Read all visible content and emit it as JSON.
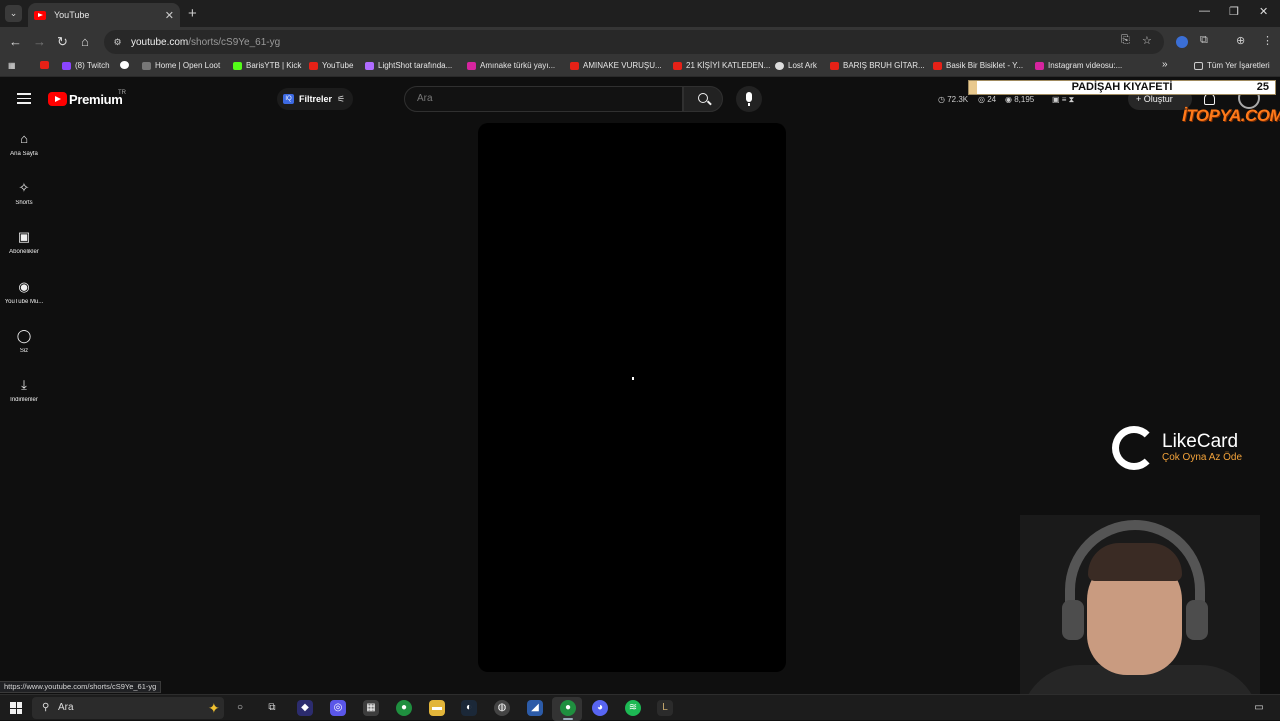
{
  "browser": {
    "tab_title": "YouTube",
    "tab_close": "✕",
    "new_tab": "+",
    "url_host": "youtube.com",
    "url_path": "/shorts/cS9Ye_61-yg",
    "window_controls": [
      "—",
      "❐",
      "✕"
    ]
  },
  "bookmarks": [
    {
      "label": "",
      "icon": "youtube"
    },
    {
      "label": "(8) Twitch",
      "icon": "twitch"
    },
    {
      "label": "",
      "icon": "google"
    },
    {
      "label": "Home | Open Loot",
      "icon": "open-loot"
    },
    {
      "label": "BarisYTB | Kick",
      "icon": "kick"
    },
    {
      "label": "YouTube",
      "icon": "youtube"
    },
    {
      "label": "LightShot tarafında...",
      "icon": "lightshot"
    },
    {
      "label": "Amınake türkü yayı...",
      "icon": "instagram"
    },
    {
      "label": "AMINAKE VURUŞU...",
      "icon": "youtube"
    },
    {
      "label": "21 KİŞİYİ KATLEDEN...",
      "icon": "youtube"
    },
    {
      "label": "Lost Ark",
      "icon": "globe"
    },
    {
      "label": "BARIŞ BRUH GİTAR...",
      "icon": "youtube"
    },
    {
      "label": "Basik Bir Bisiklet - Y...",
      "icon": "youtube"
    },
    {
      "label": "Instagram videosu:...",
      "icon": "instagram"
    },
    {
      "label": "»",
      "icon": ""
    },
    {
      "label": "Tüm Yer İşaretleri",
      "icon": "folder"
    }
  ],
  "youtube": {
    "brand": "Premium",
    "region": "TR",
    "filters_label": "Filtreler",
    "filters_badge": "IQ",
    "search_placeholder": "Ara",
    "stats": {
      "views": "72.3K",
      "count2": "24",
      "count3": "8,195"
    },
    "create_label": "+ Oluştur"
  },
  "sidebar": [
    {
      "label": "Ana Sayfa",
      "icon": "home-icon",
      "glyph": "⌂"
    },
    {
      "label": "Shorts",
      "icon": "shorts-icon",
      "glyph": "✧"
    },
    {
      "label": "Abonelikler",
      "icon": "subscriptions-icon",
      "glyph": "▣"
    },
    {
      "label": "YouTube Mu...",
      "icon": "youtube-music-icon",
      "glyph": "◉"
    },
    {
      "label": "Siz",
      "icon": "you-icon",
      "glyph": "◯"
    },
    {
      "label": "İndirilenler",
      "icon": "downloads-icon",
      "glyph": "⤓"
    }
  ],
  "overlay": {
    "banner_text": "PADİŞAH KIYAFETİ",
    "banner_number": "25",
    "sponsor": "İTOPYA.COM",
    "likecard_title": "LikeCard",
    "likecard_slogan": "Çok Oyna  Az Öde"
  },
  "status_url": "https://www.youtube.com/shorts/cS9Ye_61-yg",
  "taskbar": {
    "search_text": "Ara"
  }
}
